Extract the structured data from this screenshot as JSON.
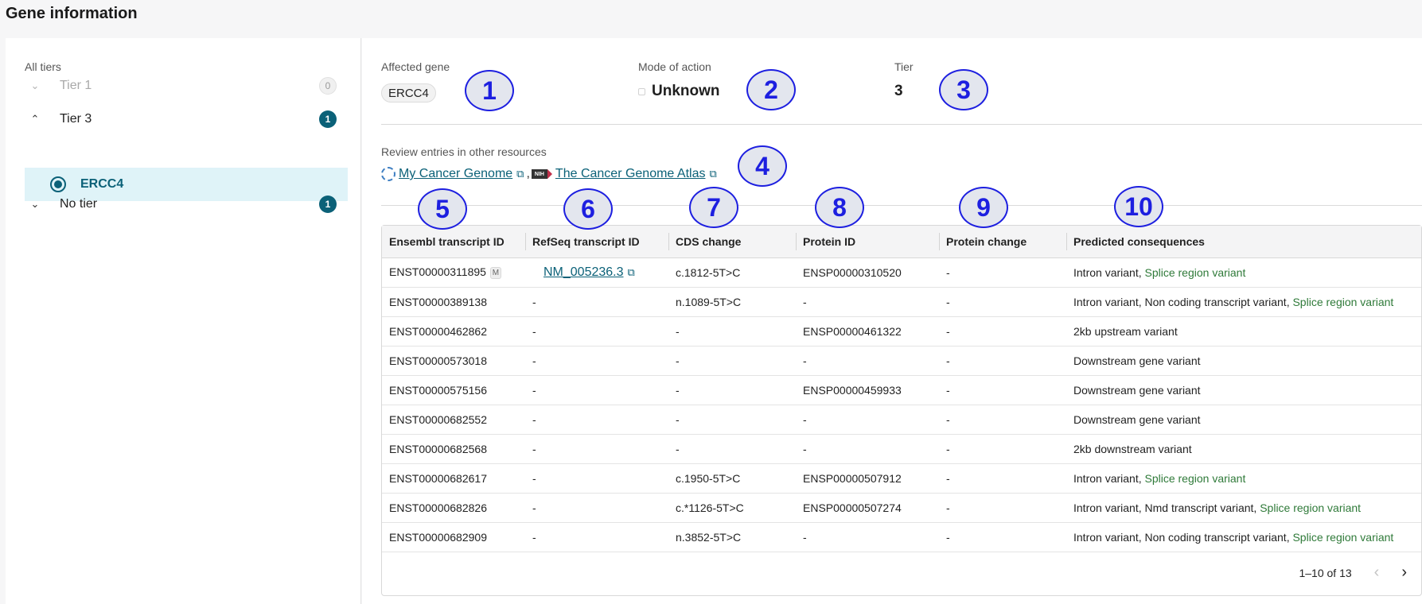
{
  "page": {
    "title": "Gene information"
  },
  "tiers": {
    "all_label": "All tiers",
    "items": [
      {
        "label": "Tier 1",
        "count": "0"
      },
      {
        "label": "Tier 3",
        "count": "1"
      },
      {
        "label": "No tier",
        "count": "1"
      }
    ],
    "selected_gene": "ERCC4"
  },
  "summary": {
    "affected_gene_label": "Affected gene",
    "affected_gene": "ERCC4",
    "mode_of_action_label": "Mode of action",
    "mode_of_action": "Unknown",
    "tier_label": "Tier",
    "tier": "3"
  },
  "resources": {
    "label": "Review entries in other resources",
    "links": [
      "My Cancer Genome",
      "The Cancer Genome Atlas"
    ],
    "nih_badge": "NIH",
    "separator": ","
  },
  "annotations": [
    "1",
    "2",
    "3",
    "4",
    "5",
    "6",
    "7",
    "8",
    "9",
    "10"
  ],
  "table": {
    "columns": [
      "Ensembl transcript ID",
      "RefSeq transcript ID",
      "CDS change",
      "Protein ID",
      "Protein change",
      "Predicted consequences"
    ],
    "mane_badge": "M",
    "rows": [
      {
        "ensembl": "ENST00000311895",
        "refseq": "NM_005236.3",
        "cds": "c.1812-5T>C",
        "protein_id": "ENSP00000310520",
        "protein_change": "-",
        "consequence": "Intron variant, ",
        "splice": "Splice region variant"
      },
      {
        "ensembl": "ENST00000389138",
        "refseq": "-",
        "cds": "n.1089-5T>C",
        "protein_id": "-",
        "protein_change": "-",
        "consequence": "Intron variant, Non coding transcript variant, ",
        "splice": "Splice region variant"
      },
      {
        "ensembl": "ENST00000462862",
        "refseq": "-",
        "cds": "-",
        "protein_id": "ENSP00000461322",
        "protein_change": "-",
        "consequence": "2kb upstream variant",
        "splice": ""
      },
      {
        "ensembl": "ENST00000573018",
        "refseq": "-",
        "cds": "-",
        "protein_id": "-",
        "protein_change": "-",
        "consequence": "Downstream gene variant",
        "splice": ""
      },
      {
        "ensembl": "ENST00000575156",
        "refseq": "-",
        "cds": "-",
        "protein_id": "ENSP00000459933",
        "protein_change": "-",
        "consequence": "Downstream gene variant",
        "splice": ""
      },
      {
        "ensembl": "ENST00000682552",
        "refseq": "-",
        "cds": "-",
        "protein_id": "-",
        "protein_change": "-",
        "consequence": "Downstream gene variant",
        "splice": ""
      },
      {
        "ensembl": "ENST00000682568",
        "refseq": "-",
        "cds": "-",
        "protein_id": "-",
        "protein_change": "-",
        "consequence": "2kb downstream variant",
        "splice": ""
      },
      {
        "ensembl": "ENST00000682617",
        "refseq": "-",
        "cds": "c.1950-5T>C",
        "protein_id": "ENSP00000507912",
        "protein_change": "-",
        "consequence": "Intron variant, ",
        "splice": "Splice region variant"
      },
      {
        "ensembl": "ENST00000682826",
        "refseq": "-",
        "cds": "c.*1126-5T>C",
        "protein_id": "ENSP00000507274",
        "protein_change": "-",
        "consequence": "Intron variant, Nmd transcript variant, ",
        "splice": "Splice region variant"
      },
      {
        "ensembl": "ENST00000682909",
        "refseq": "-",
        "cds": "n.3852-5T>C",
        "protein_id": "-",
        "protein_change": "-",
        "consequence": "Intron variant, Non coding transcript variant, ",
        "splice": "Splice region variant"
      }
    ]
  },
  "pagination": {
    "range_text": "1–10 of 13"
  },
  "icons": {
    "chevron_down": "chevron-down-icon",
    "chevron_up": "chevron-up-icon",
    "external_link": "external-link-icon",
    "prev": "chevron-left-icon",
    "next": "chevron-right-icon"
  }
}
